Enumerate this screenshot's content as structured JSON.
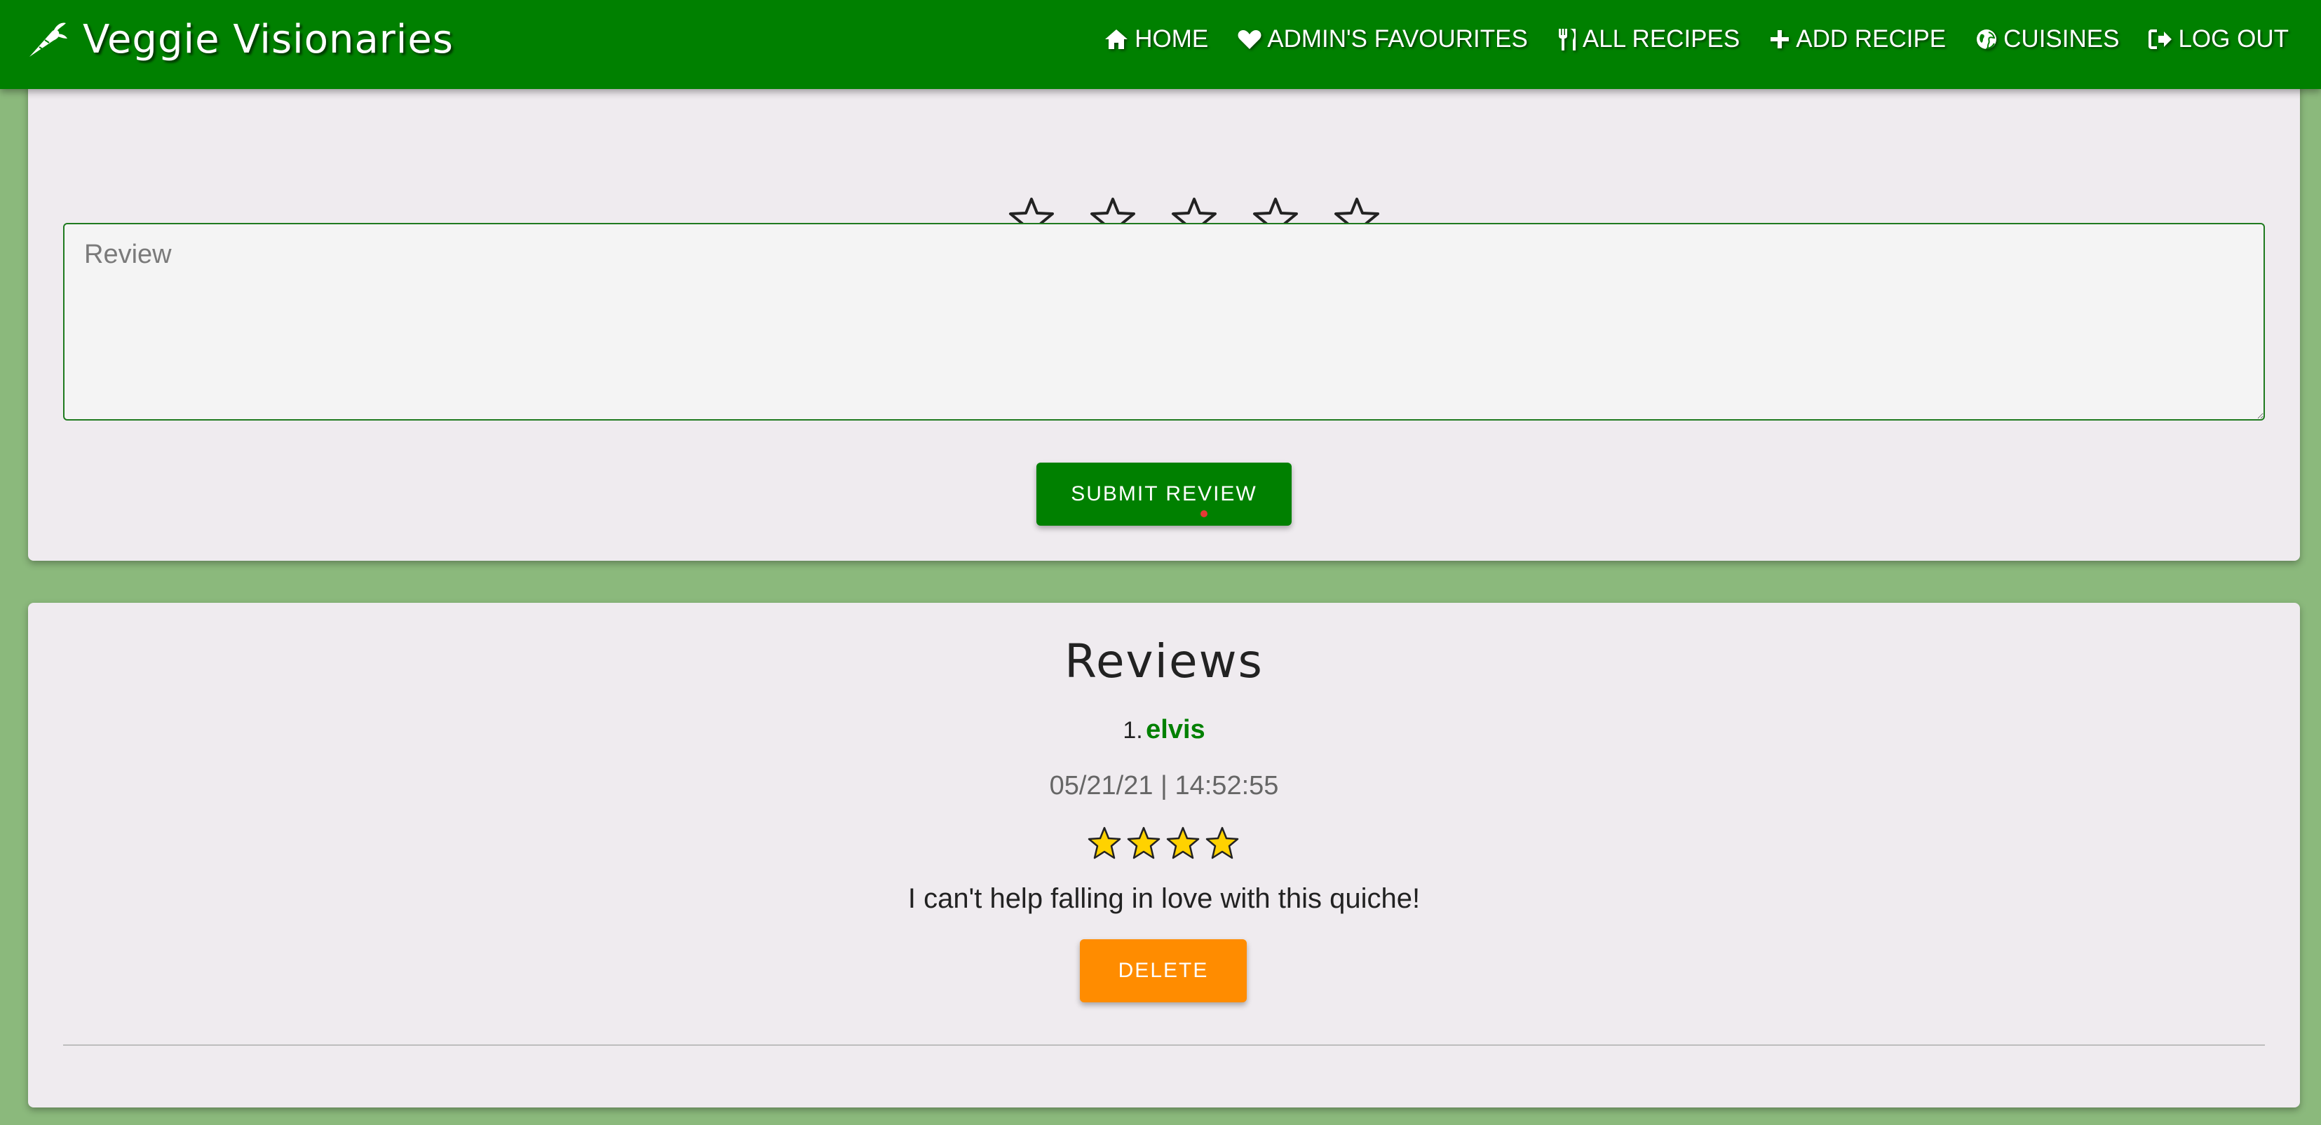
{
  "brand": {
    "name": "Veggie Visionaries",
    "logo_icon": "carrot-icon"
  },
  "nav": {
    "items": [
      {
        "label": "HOME",
        "icon": "home-icon"
      },
      {
        "label": "ADMIN'S FAVOURITES",
        "icon": "heart-icon"
      },
      {
        "label": "ALL RECIPES",
        "icon": "utensils-icon"
      },
      {
        "label": "ADD RECIPE",
        "icon": "plus-icon"
      },
      {
        "label": "CUISINES",
        "icon": "globe-icon"
      },
      {
        "label": "LOG OUT",
        "icon": "sign-out-icon"
      }
    ]
  },
  "review_form": {
    "rating_selected": 0,
    "rating_max": 5,
    "textarea_placeholder": "Review",
    "textarea_value": "",
    "submit_label": "SUBMIT REVIEW"
  },
  "reviews": {
    "title": "Reviews",
    "items": [
      {
        "number": "1.",
        "author": "elvis",
        "date": "05/21/21 | 14:52:55",
        "rating": 4,
        "text": "I can't help falling in love with this quiche!",
        "delete_label": "DELETE"
      }
    ]
  },
  "colors": {
    "nav_bg": "#008000",
    "page_bg": "#8bb97c",
    "card_bg": "#efebef",
    "primary_button": "#008000",
    "delete_button": "#ff8c00",
    "author_link": "#008000",
    "star_filled": "#ffd200"
  }
}
